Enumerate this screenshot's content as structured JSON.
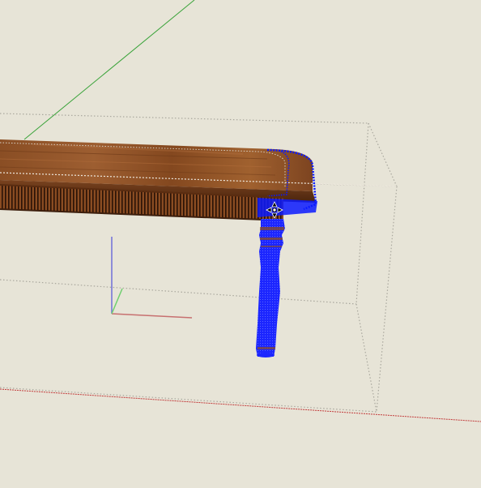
{
  "app": {
    "view": "3d-modeling-viewport"
  },
  "scene": {
    "background_color": "#e7e4d7",
    "axis_colors": {
      "red": "#c23b3b",
      "green": "#3aa33a",
      "blue": "#3a3ad6"
    },
    "selection_color": "#0a1aff",
    "wood_colors": {
      "light": "#9a5a2e",
      "mid": "#7a431f",
      "dark": "#3d1e0c"
    },
    "bounding_box_color": "#a9a79d",
    "model": {
      "name": "table",
      "selected_component": "table-leg",
      "parts": [
        "tabletop",
        "apron",
        "table-leg"
      ]
    },
    "cursor_icon": "move-cursor-icon"
  }
}
